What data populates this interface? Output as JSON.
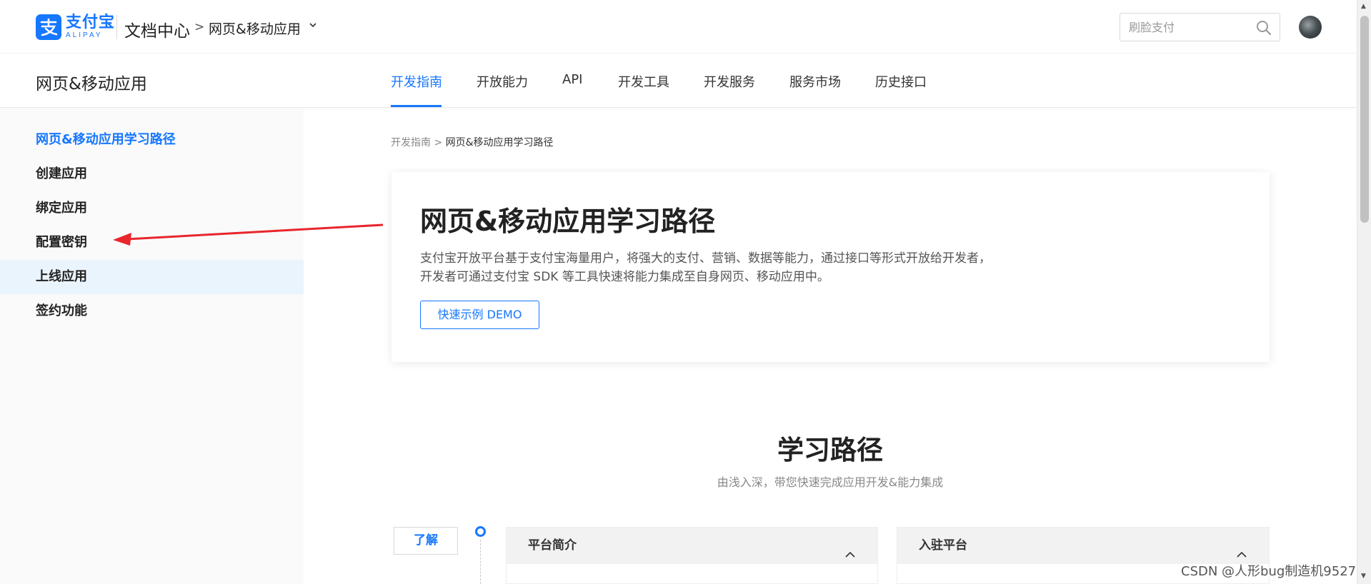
{
  "header": {
    "logo_cn": "支付宝",
    "logo_en": "ALIPAY",
    "doc_center": "文档中心",
    "crumb_sep": ">",
    "crumb_app": "网页&移动应用",
    "search_placeholder": "刷脸支付"
  },
  "subnav": {
    "title": "网页&移动应用",
    "tabs": [
      {
        "label": "开发指南",
        "active": true
      },
      {
        "label": "开放能力"
      },
      {
        "label": "API"
      },
      {
        "label": "开发工具"
      },
      {
        "label": "开发服务"
      },
      {
        "label": "服务市场"
      },
      {
        "label": "历史接口"
      }
    ]
  },
  "sidebar": {
    "items": [
      {
        "label": "网页&移动应用学习路径",
        "active": true
      },
      {
        "label": "创建应用"
      },
      {
        "label": "绑定应用"
      },
      {
        "label": "配置密钥"
      },
      {
        "label": "上线应用",
        "hover": true
      },
      {
        "label": "签约功能"
      }
    ]
  },
  "main": {
    "breadcrumb_root": "开发指南",
    "breadcrumb_sep": ">",
    "breadcrumb_current": "网页&移动应用学习路径",
    "hero_title": "网页&移动应用学习路径",
    "hero_desc": "支付宝开放平台基于支付宝海量用户，将强大的支付、营销、数据等能力，通过接口等形式开放给开发者，开发者可通过支付宝 SDK 等工具快速将能力集成至自身网页、移动应用中。",
    "demo_button": "快速示例 DEMO",
    "section_title": "学习路径",
    "section_sub": "由浅入深，带您快速完成应用开发&能力集成",
    "stage_tag": "了解",
    "cards": [
      {
        "title": "平台简介"
      },
      {
        "title": "入驻平台"
      }
    ]
  },
  "watermark": "CSDN @人形bug制造机9527",
  "colors": {
    "accent": "#1677ff",
    "annotation_arrow": "#e8262b",
    "sidebar_bg": "#fafafa",
    "sidebar_hover": "#eaf4fd"
  }
}
